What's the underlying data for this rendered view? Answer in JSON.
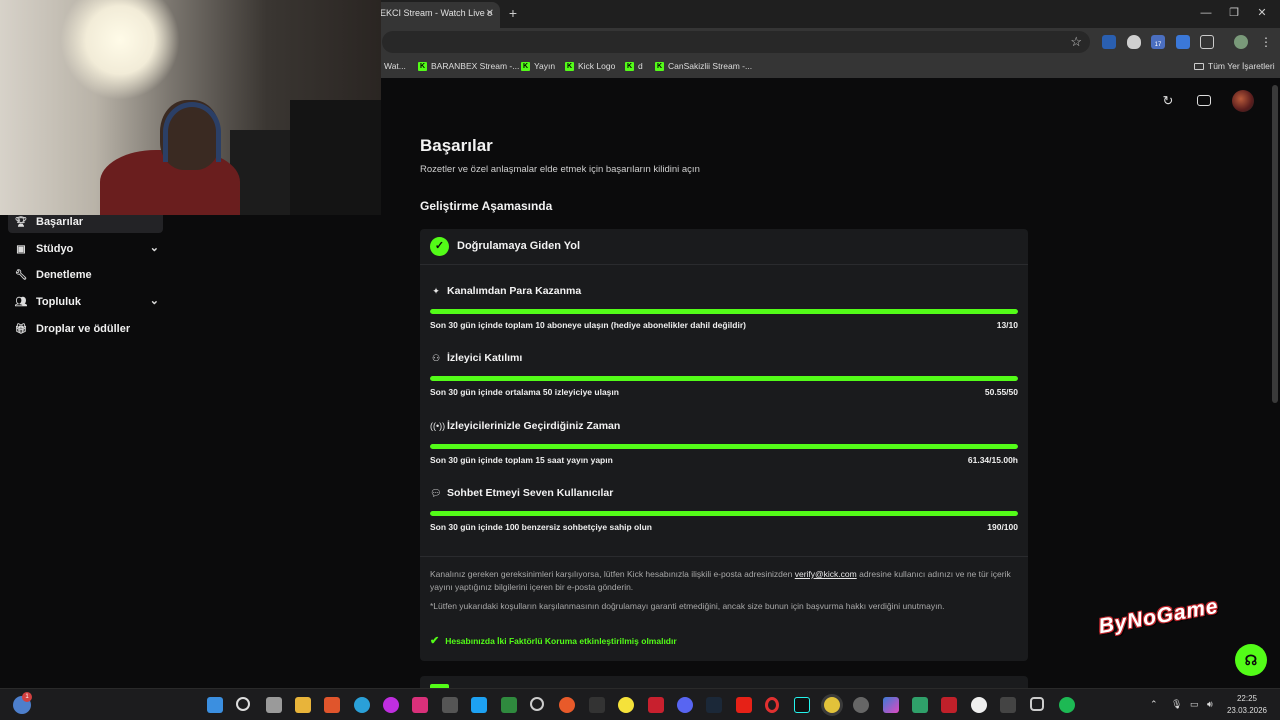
{
  "browser": {
    "tab_title": "EKCI Stream - Watch Live o",
    "bookmarks": [
      {
        "label": "Wat..."
      },
      {
        "label": "BARANBEX Stream -..."
      },
      {
        "label": "Yayın"
      },
      {
        "label": "Kick Logo"
      },
      {
        "label": "d"
      },
      {
        "label": "CanSakizlii Stream -..."
      }
    ],
    "all_bookmarks": "Tüm Yer İşaretleri",
    "extension_badge": "17"
  },
  "sidebar": {
    "items": [
      {
        "label": "Başarılar",
        "icon": "trophy-icon",
        "active": true
      },
      {
        "label": "Stüdyo",
        "icon": "studio-icon",
        "chevron": true
      },
      {
        "label": "Denetleme",
        "icon": "wrench-icon"
      },
      {
        "label": "Topluluk",
        "icon": "community-icon",
        "chevron": true
      },
      {
        "label": "Droplar ve ödüller",
        "icon": "gift-icon"
      }
    ]
  },
  "page": {
    "title": "Başarılar",
    "subtitle": "Rozetler ve özel anlaşmalar elde etmek için başarıların kilidini açın",
    "section_title": "Geliştirme Aşamasında"
  },
  "card": {
    "title": "Doğrulamaya Giden Yol",
    "requirements": [
      {
        "icon": "sparkle-icon",
        "title": "Kanalımdan Para Kazanma",
        "description": "Son 30 gün içinde toplam 10 aboneye ulaşın (hediye abonelikler dahil değildir)",
        "value": "13/10",
        "progress": 1.0
      },
      {
        "icon": "viewers-icon",
        "title": "İzleyici Katılımı",
        "description": "Son 30 gün içinde ortalama 50 izleyiciye ulaşın",
        "value": "50.55/50",
        "progress": 1.0
      },
      {
        "icon": "broadcast-icon",
        "title": "İzleyicilerinizle Geçirdiğiniz Zaman",
        "description": "Son 30 gün içinde toplam 15 saat yayın yapın",
        "value": "61.34/15.00h",
        "progress": 1.0
      },
      {
        "icon": "chat-icon",
        "title": "Sohbet Etmeyi Seven Kullanıcılar",
        "description": "Son 30 gün içinde 100 benzersiz sohbetçiye sahip olun",
        "value": "190/100",
        "progress": 1.0
      }
    ],
    "note1_before": "Kanalınız gereken gereksinimleri karşılıyorsa, lütfen Kick hesabınızla ilişkili e-posta adresinizden ",
    "note1_link": "verify@kick.com",
    "note1_after": " adresine kullanıcı adınızı ve ne tür içerik yayını yaptığınız bilgilerini içeren bir e-posta gönderin.",
    "note2": "*Lütfen yukarıdaki koşulların karşılanmasının doğrulamayı garanti etmediğini, ancak size bunun için başvurma hakkı verdiğini unutmayın.",
    "check": "Hesabınızda İki Faktörlü Koruma etkinleştirilmiş olmalıdır"
  },
  "overlay": {
    "logo": "ByNoGame"
  },
  "taskbar": {
    "time": "22:25",
    "date": "23.03.2026",
    "weather_badge": "1"
  },
  "colors": {
    "accent": "#53fc18",
    "background": "#0b0b0c",
    "card": "#1a1b1d"
  }
}
